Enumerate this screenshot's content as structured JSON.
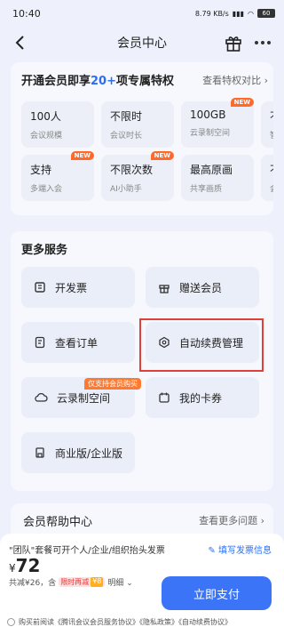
{
  "status_bar": {
    "time": "10:40",
    "net": "8.79 KB/s",
    "battery": "60"
  },
  "header": {
    "title": "会员中心"
  },
  "privileges": {
    "title_prefix": "开通会员即享",
    "title_highlight": "20+",
    "title_suffix": "项专属特权",
    "compare_link": "查看特权对比 ›",
    "items": [
      {
        "title": "100人",
        "sub": "会议规模",
        "badge": ""
      },
      {
        "title": "不限时",
        "sub": "会议时长",
        "badge": ""
      },
      {
        "title": "100GB",
        "sub": "云录制空间",
        "badge": "NEW"
      },
      {
        "title": "不限",
        "sub": "智能",
        "badge": ""
      },
      {
        "title": "支持",
        "sub": "多端入会",
        "badge": "NEW"
      },
      {
        "title": "不限次数",
        "sub": "AI小助手",
        "badge": "NEW"
      },
      {
        "title": "最高原画",
        "sub": "共享画质",
        "badge": ""
      },
      {
        "title": "不",
        "sub": "会话",
        "badge": ""
      }
    ]
  },
  "services": {
    "title": "更多服务",
    "items": [
      {
        "label": "开发票",
        "icon": "invoice-icon"
      },
      {
        "label": "赠送会员",
        "icon": "gift-icon"
      },
      {
        "label": "查看订单",
        "icon": "order-icon"
      },
      {
        "label": "自动续费管理",
        "icon": "auto-renew-icon"
      },
      {
        "label": "云录制空间",
        "icon": "cloud-icon"
      },
      {
        "label": "我的卡券",
        "icon": "coupon-icon"
      },
      {
        "label": "商业版/企业版",
        "icon": "enterprise-icon"
      }
    ],
    "cloud_tag": "仅支持会员购买"
  },
  "help": {
    "title": "会员帮助中心",
    "more": "查看更多问题 ›"
  },
  "checkout": {
    "invoice_note": "\"团队\"套餐可开个人/企业/组织抬头发票",
    "invoice_link": "填写发票信息",
    "currency": "¥",
    "price": "72",
    "discount_text": "共减¥26，含",
    "limited_label": "限时再减",
    "limited_amount": "¥8",
    "detail_label": "明细 ⌄",
    "pay_button": "立即支付",
    "agreement": "购买前阅读《腾讯会议会员服务协议》《隐私政策》《自动续费协议》"
  }
}
